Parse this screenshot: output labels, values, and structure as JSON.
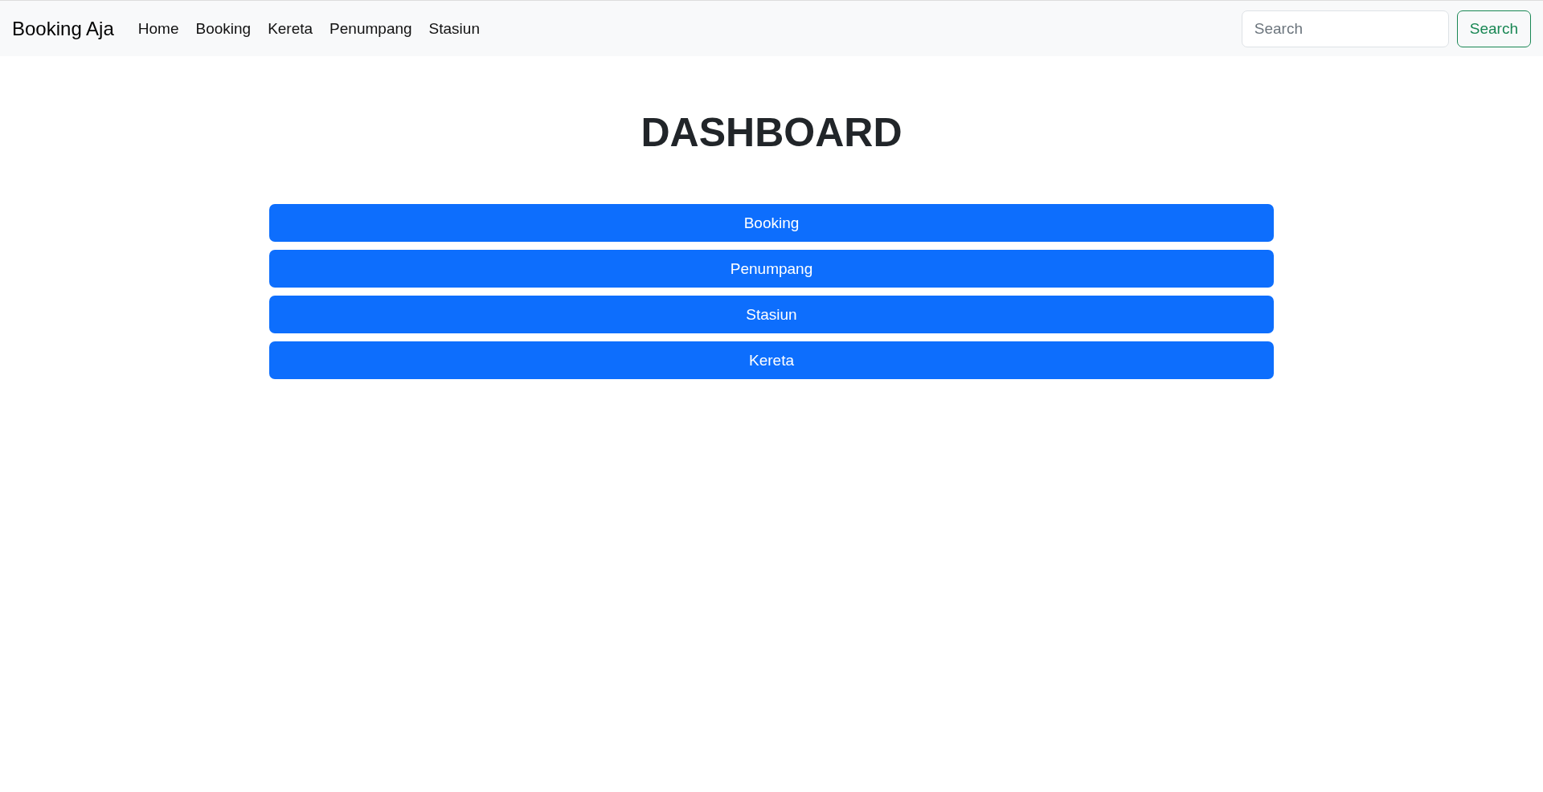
{
  "navbar": {
    "brand": "Booking Aja",
    "links": [
      "Home",
      "Booking",
      "Kereta",
      "Penumpang",
      "Stasiun"
    ],
    "search": {
      "placeholder": "Search"
    },
    "search_button": "Search"
  },
  "title": "DASHBOARD",
  "buttons": [
    "Booking",
    "Penumpang",
    "Stasiun",
    "Kereta"
  ]
}
